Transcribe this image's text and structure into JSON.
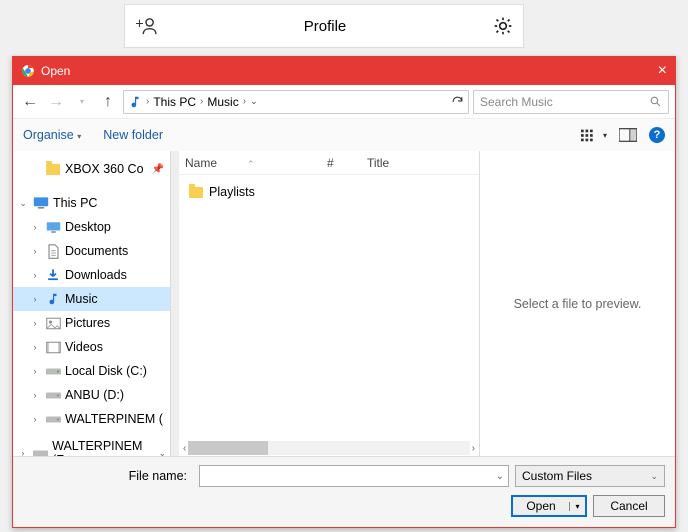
{
  "profilebar": {
    "title": "Profile"
  },
  "dialog": {
    "title": "Open",
    "breadcrumbs": [
      "This PC",
      "Music"
    ],
    "search_placeholder": "Search Music",
    "organise_label": "Organise",
    "newfolder_label": "New folder",
    "file_columns": {
      "name": "Name",
      "num": "#",
      "title": "Title"
    },
    "files": [
      {
        "name": "Playlists"
      }
    ],
    "preview_text": "Select a file to preview.",
    "filename_label": "File name:",
    "filetype_label": "Custom Files",
    "open_label": "Open",
    "cancel_label": "Cancel"
  },
  "tree": {
    "top_item": "XBOX 360 Co",
    "root": "This PC",
    "children": [
      "Desktop",
      "Documents",
      "Downloads",
      "Music",
      "Pictures",
      "Videos",
      "Local Disk (C:)",
      "ANBU (D:)",
      "WALTERPINEM ("
    ],
    "bottom_item": "WALTERPINEM (F"
  }
}
